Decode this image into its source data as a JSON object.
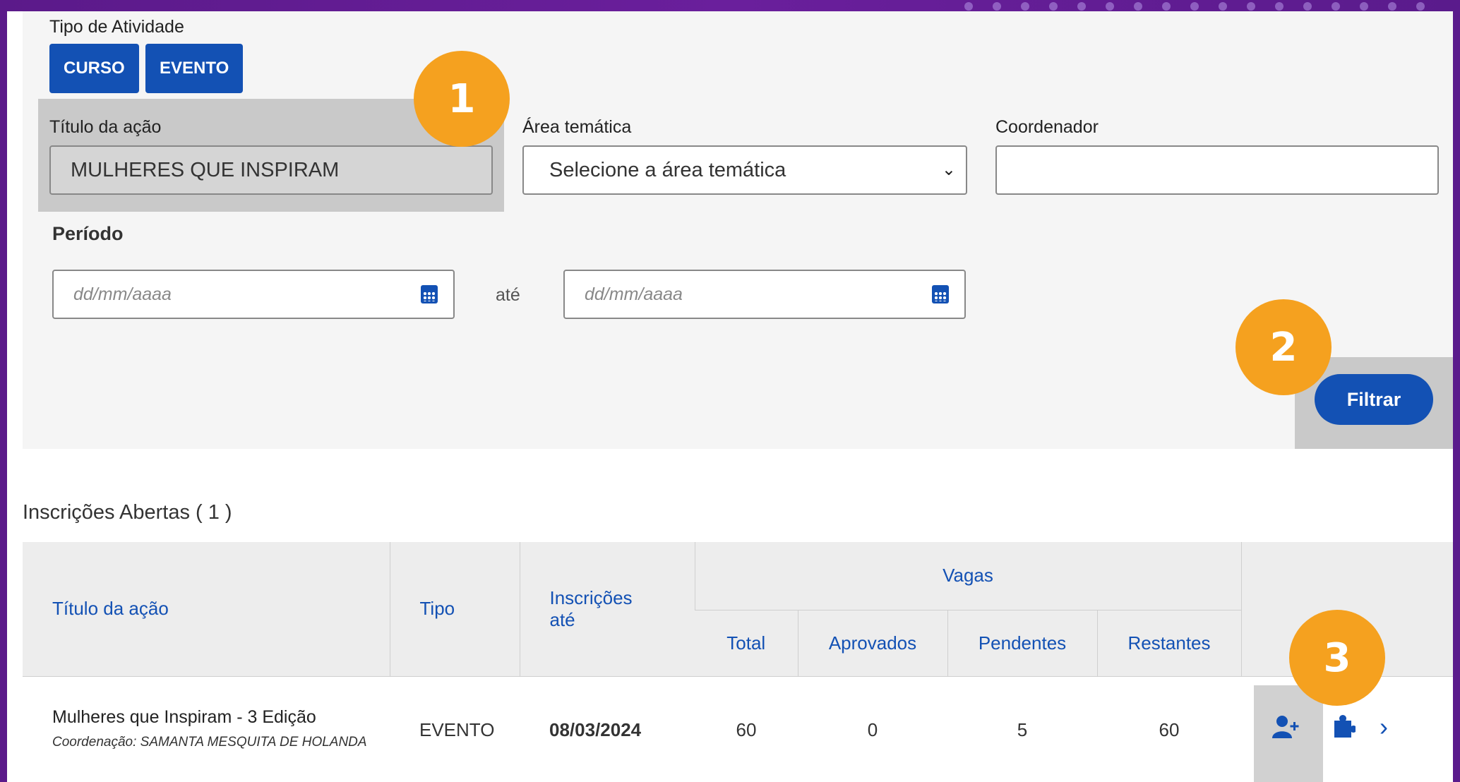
{
  "filters": {
    "activity_type_label": "Tipo de Atividade",
    "type_buttons": [
      "CURSO",
      "EVENTO"
    ],
    "title_label": "Título da ação",
    "title_value": "MULHERES QUE INSPIRAM",
    "area_label": "Área temática",
    "area_selected": "Selecione a área temática",
    "coordinator_label": "Coordenador",
    "coordinator_value": "",
    "period_label": "Período",
    "date_from_placeholder": "dd/mm/aaaa",
    "date_to_placeholder": "dd/mm/aaaa",
    "until_text": "até",
    "filter_button": "Filtrar"
  },
  "badges": [
    "1",
    "2",
    "3"
  ],
  "section": {
    "title": "Inscrições Abertas ( 1 )"
  },
  "table": {
    "headers": {
      "title": "Título da ação",
      "type": "Tipo",
      "deadline": "Inscrições até",
      "vagas": "Vagas",
      "total": "Total",
      "approved": "Aprovados",
      "pending": "Pendentes",
      "remaining": "Restantes"
    },
    "rows": [
      {
        "title": "Mulheres que Inspiram - 3 Edição",
        "coordination": "Coordenação: SAMANTA MESQUITA DE HOLANDA",
        "type": "EVENTO",
        "deadline": "08/03/2024",
        "total": "60",
        "approved": "0",
        "pending": "5",
        "remaining": "60"
      }
    ]
  },
  "colors": {
    "primary": "#1351b4",
    "badge": "#f5a11f",
    "background_purple": "#6a1f9c"
  },
  "icons": [
    "calendar-icon",
    "user-plus-icon",
    "puzzle-icon",
    "chevron-right-icon"
  ]
}
